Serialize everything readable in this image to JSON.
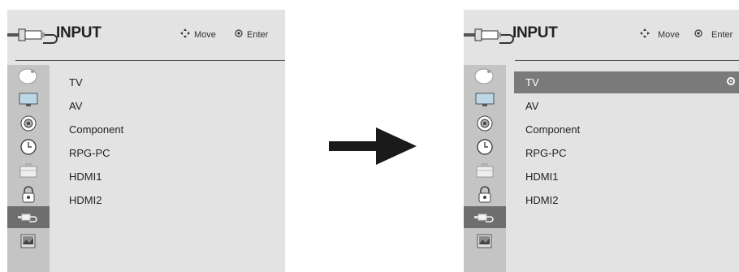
{
  "left_panel": {
    "title": "INPUT",
    "hint_move": "Move",
    "hint_enter": "Enter",
    "items": [
      {
        "label": "TV"
      },
      {
        "label": "AV"
      },
      {
        "label": "Component"
      },
      {
        "label": "RPG-PC"
      },
      {
        "label": "HDMI1"
      },
      {
        "label": "HDMI2"
      }
    ]
  },
  "right_panel": {
    "title": "INPUT",
    "hint_move": "Move",
    "hint_enter": "Enter",
    "selected_index": 0,
    "items": [
      {
        "label": "TV"
      },
      {
        "label": "AV"
      },
      {
        "label": "Component"
      },
      {
        "label": "RPG-PC"
      },
      {
        "label": "HDMI1"
      },
      {
        "label": "HDMI2"
      }
    ]
  },
  "sidebar_icons": [
    "satellite-dish-icon",
    "monitor-icon",
    "speaker-icon",
    "clock-icon",
    "briefcase-icon",
    "lock-icon",
    "input-plug-icon",
    "photo-icon"
  ],
  "active_sidebar_index": 6,
  "colors": {
    "panel_bg": "#e3e3e3",
    "sidebar_bg": "#c4c4c4",
    "active_sidebar": "#6e6e6e",
    "selected_row": "#7a7a7a"
  }
}
